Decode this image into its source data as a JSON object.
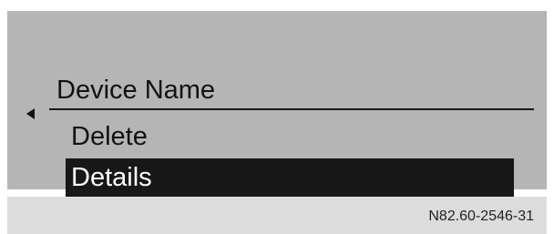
{
  "screen": {
    "title": "Device Name",
    "back_icon": "left-triangle-icon",
    "menu": [
      {
        "label": "Delete",
        "selected": false
      },
      {
        "label": "Details",
        "selected": true
      }
    ]
  },
  "footer": {
    "reference_code": "N82.60-2546-31"
  },
  "colors": {
    "screen_background": "#b5b5b5",
    "selection_background": "#181818",
    "selection_text": "#ffffff",
    "text": "#121212"
  }
}
